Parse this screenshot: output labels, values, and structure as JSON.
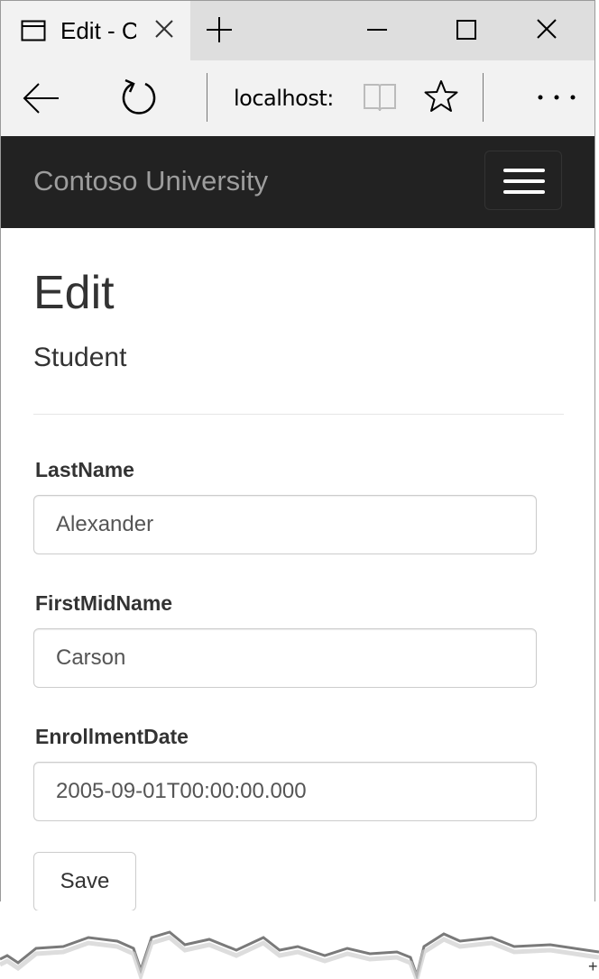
{
  "browser": {
    "tab_title": "Edit - C",
    "url": "localhost:",
    "icons": {
      "tab": "tab-page-icon",
      "close": "close-icon",
      "new_tab": "plus-icon",
      "minimize": "minimize-icon",
      "maximize": "maximize-icon",
      "window_close": "close-icon",
      "back": "back-arrow-icon",
      "refresh": "refresh-icon",
      "reading_view": "book-icon",
      "favorite": "star-icon",
      "more": "more-icon"
    }
  },
  "navbar": {
    "brand": "Contoso University",
    "menu_icon": "hamburger-icon",
    "background": "#222222",
    "brand_color": "#9d9d9d"
  },
  "page": {
    "heading": "Edit",
    "subheading": "Student"
  },
  "form": {
    "last_name": {
      "label": "LastName",
      "value": "Alexander"
    },
    "first_mid_name": {
      "label": "FirstMidName",
      "value": "Carson"
    },
    "enrollment_date": {
      "label": "EnrollmentDate",
      "value": "2005-09-01T00:00:00.000"
    },
    "save_label": "Save"
  },
  "footer_mark": "+"
}
